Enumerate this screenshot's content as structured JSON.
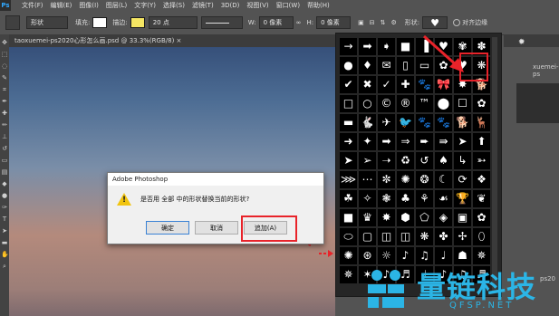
{
  "menubar": {
    "logo": "Ps",
    "items": [
      "文件(F)",
      "编辑(E)",
      "图像(I)",
      "图层(L)",
      "文字(Y)",
      "选择(S)",
      "滤镜(T)",
      "3D(D)",
      "视图(V)",
      "窗口(W)",
      "帮助(H)"
    ]
  },
  "options": {
    "mode": "形状",
    "fill_label": "填充:",
    "stroke_label": "描边:",
    "stroke_size": "20 点",
    "w_label": "W:",
    "w_value": "0 像素",
    "h_label": "H:",
    "h_value": "0 像素",
    "shape_label": "形状:",
    "align_edges": "对齐边缘",
    "fill_color": "#ffffff",
    "stroke_color": "#f5e663"
  },
  "document": {
    "tab": "taoxuemei-ps2020心形怎么画.psd @ 33.3%(RGB/8) ×"
  },
  "right_panel": {
    "item1": "xuemei-ps",
    "item2": "ps20"
  },
  "dialog": {
    "title": "Adobe Photoshop",
    "message": "是否用 全部 中的形状替换当前的形状?",
    "ok": "确定",
    "cancel": "取消",
    "append": "追加(A)"
  },
  "shape_picker": {
    "shapes": [
      "→",
      "➡",
      "➧",
      "■",
      "▐",
      "♥",
      "✾",
      "✽",
      "●",
      "♦",
      "✉",
      "▯",
      "▭",
      "✿",
      "♥",
      "❋",
      "✔",
      "✖",
      "✓",
      "✚",
      "🐾",
      "🎀",
      "✸",
      "🐕",
      "□",
      "○",
      "©",
      "®",
      "™",
      "⬤",
      "☐",
      "✿",
      "▬",
      "🐇",
      "✈",
      "🐦",
      "🐾",
      "🐾",
      "🐕",
      "🦌",
      "➜",
      "✦",
      "➡",
      "⇒",
      "➨",
      "⇛",
      "➤",
      "⬆",
      "➤",
      "➢",
      "➝",
      "♻",
      "↺",
      "♠",
      "↳",
      "➳",
      "⋙",
      "⋯",
      "✼",
      "✺",
      "❂",
      "☾",
      "⟳",
      "❖",
      "☘",
      "✧",
      "❃",
      "♣",
      "⚘",
      "☙",
      "🏆",
      "❦",
      "■",
      "♛",
      "✸",
      "⬢",
      "⬠",
      "◈",
      "▣",
      "✿",
      "⬭",
      "▢",
      "◫",
      "◫",
      "❋",
      "✤",
      "✢",
      "⬯",
      "✺",
      "⊛",
      "☼",
      "♪",
      "♫",
      "♩",
      "☗",
      "✵",
      "✵",
      "✶",
      "♪",
      "♬",
      "♩",
      "♪",
      "♫",
      "♬"
    ],
    "selected": "heart"
  },
  "watermark": {
    "text": "量链科技",
    "sub": "QFSP.NET"
  }
}
